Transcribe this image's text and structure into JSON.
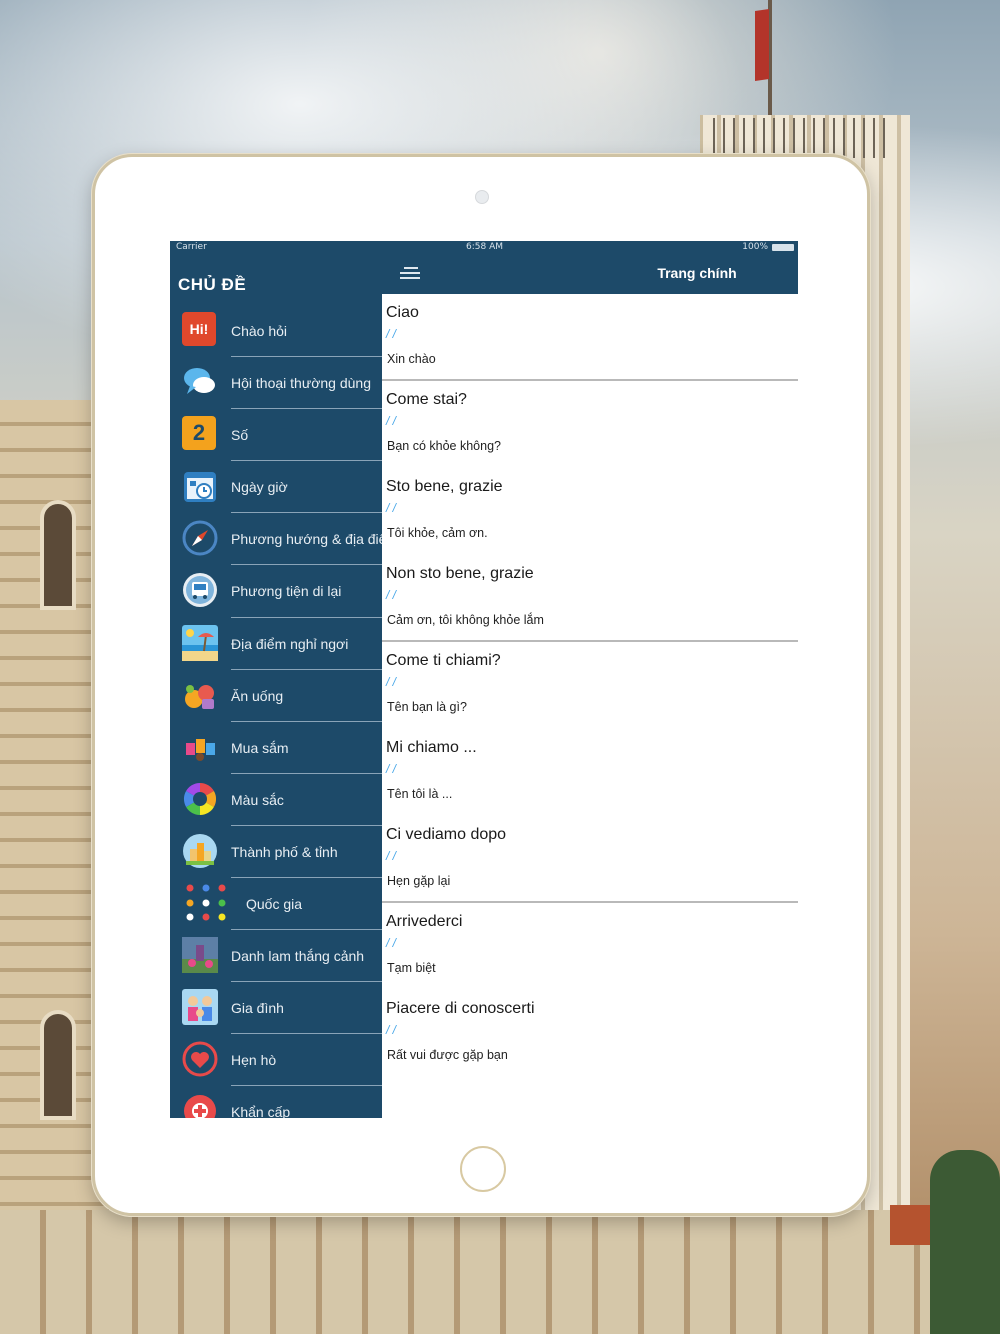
{
  "status_bar": {
    "carrier": "Carrier",
    "time": "6:58 AM",
    "battery": "100%"
  },
  "sidebar": {
    "title": "CHỦ ĐỀ",
    "items": [
      {
        "label": "Chào hỏi",
        "icon": "hi-greeting-icon"
      },
      {
        "label": "Hội thoại thường dùng",
        "icon": "speech-bubbles-icon"
      },
      {
        "label": "Số",
        "icon": "number-two-icon"
      },
      {
        "label": "Ngày giờ",
        "icon": "calendar-clock-icon"
      },
      {
        "label": "Phương hướng & địa điểm",
        "icon": "compass-icon"
      },
      {
        "label": "Phương tiện di lại",
        "icon": "bus-icon"
      },
      {
        "label": "Địa điểm nghỉ ngơi",
        "icon": "beach-icon"
      },
      {
        "label": "Ăn uống",
        "icon": "food-icon"
      },
      {
        "label": "Mua sắm",
        "icon": "shopping-bags-icon"
      },
      {
        "label": "Màu sắc",
        "icon": "color-wheel-icon"
      },
      {
        "label": "Thành phố & tỉnh",
        "icon": "city-icon"
      },
      {
        "label": "Quốc gia",
        "icon": "flag-pins-icon"
      },
      {
        "label": "Danh lam thắng cảnh",
        "icon": "landmark-photo-icon"
      },
      {
        "label": "Gia đình",
        "icon": "family-icon"
      },
      {
        "label": "Hẹn hò",
        "icon": "heart-icon"
      },
      {
        "label": "Khẩn cấp",
        "icon": "emergency-icon"
      }
    ]
  },
  "navbar": {
    "title": "Trang chính",
    "menu_icon": "hamburger-menu-icon"
  },
  "phrases": [
    {
      "italian": "Ciao",
      "pronunciation": "/ /",
      "vietnamese": "Xin chào",
      "divider": true
    },
    {
      "italian": "Come stai?",
      "pronunciation": "/ /",
      "vietnamese": "Bạn có khỏe không?",
      "divider": false
    },
    {
      "italian": "Sto bene, grazie",
      "pronunciation": "/ /",
      "vietnamese": "Tôi khỏe, cảm ơn.",
      "divider": false
    },
    {
      "italian": "Non sto bene, grazie",
      "pronunciation": "/ /",
      "vietnamese": "Cảm ơn, tôi không khỏe lắm",
      "divider": true
    },
    {
      "italian": "Come ti chiami?",
      "pronunciation": "/ /",
      "vietnamese": "Tên bạn là gì?",
      "divider": false
    },
    {
      "italian": "Mi chiamo ...",
      "pronunciation": "/ /",
      "vietnamese": "Tên tôi là ...",
      "divider": false
    },
    {
      "italian": "Ci vediamo dopo",
      "pronunciation": "/ /",
      "vietnamese": "Hẹn gặp lại",
      "divider": true
    },
    {
      "italian": "Arrivederci",
      "pronunciation": "/ /",
      "vietnamese": "Tạm biệt",
      "divider": false
    },
    {
      "italian": "Piacere di conoscerti",
      "pronunciation": "/ /",
      "vietnamese": "Rất vui được gặp bạn",
      "divider": false
    }
  ]
}
